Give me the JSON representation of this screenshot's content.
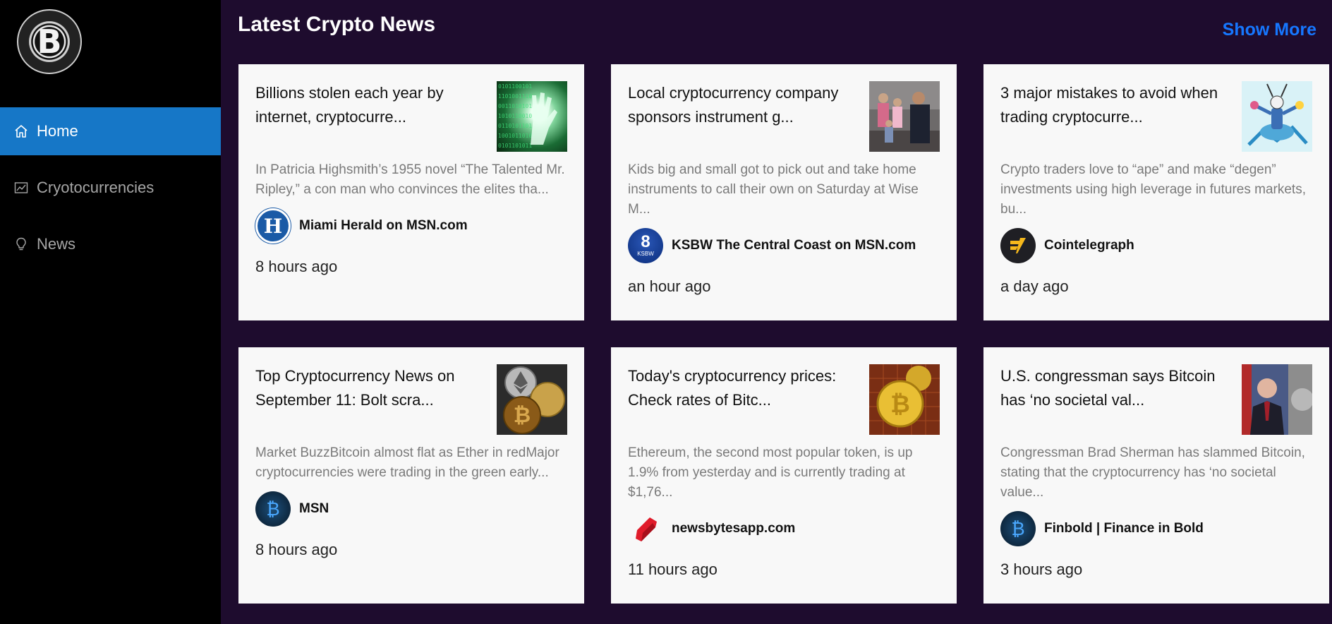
{
  "sidebar": {
    "logo_letter": "B",
    "items": [
      {
        "label": "Home",
        "icon": "home-icon",
        "active": true
      },
      {
        "label": "Cryotocurrencies",
        "icon": "chart-icon",
        "active": false
      },
      {
        "label": "News",
        "icon": "bulb-icon",
        "active": false
      }
    ]
  },
  "main": {
    "title": "Latest Crypto News",
    "show_more": "Show More"
  },
  "cards": [
    {
      "title": "Billions stolen each year by internet, cryptocurre...",
      "description": "In Patricia Highsmith’s 1955 novel “The Talented Mr. Ripley,” a con man who convinces the elites tha...",
      "provider": "Miami Herald on MSN.com",
      "avatar_text": "H",
      "time": "8 hours ago"
    },
    {
      "title": "Local cryptocurrency company sponsors instrument g...",
      "description": "Kids big and small got to pick out and take home instruments to call their own on Saturday at Wise M...",
      "provider": "KSBW The Central Coast on MSN.com",
      "avatar_text": "8",
      "avatar_subtext": "KSBW",
      "time": "an hour ago"
    },
    {
      "title": "3 major mistakes to avoid when trading cryptocurre...",
      "description": "Crypto traders love to “ape” and make “degen” investments using high leverage in futures markets, bu...",
      "provider": "Cointelegraph",
      "time": "a day ago"
    },
    {
      "title": "Top Cryptocurrency News on September 11: Bolt scra...",
      "description": "Market BuzzBitcoin almost flat as Ether in redMajor cryptocurrencies were trading in the green early...",
      "provider": "MSN",
      "avatar_text": "₿",
      "time": "8 hours ago"
    },
    {
      "title": "Today's cryptocurrency prices: Check rates of Bitc...",
      "description": "Ethereum, the second most popular token, is up 1.9% from yesterday and is currently trading at $1,76...",
      "provider": "newsbytesapp.com",
      "time": "11 hours ago"
    },
    {
      "title": "U.S. congressman says Bitcoin has ‘no societal val...",
      "description": "Congressman Brad Sherman has slammed Bitcoin, stating that the cryptocurrency has ‘no societal value...",
      "provider": "Finbold | Finance in Bold",
      "avatar_text": "₿",
      "time": "3 hours ago"
    }
  ],
  "colors": {
    "background": "#1e0c2e",
    "sidebar": "#000000",
    "active": "#1677c7",
    "link": "#1677ff"
  }
}
